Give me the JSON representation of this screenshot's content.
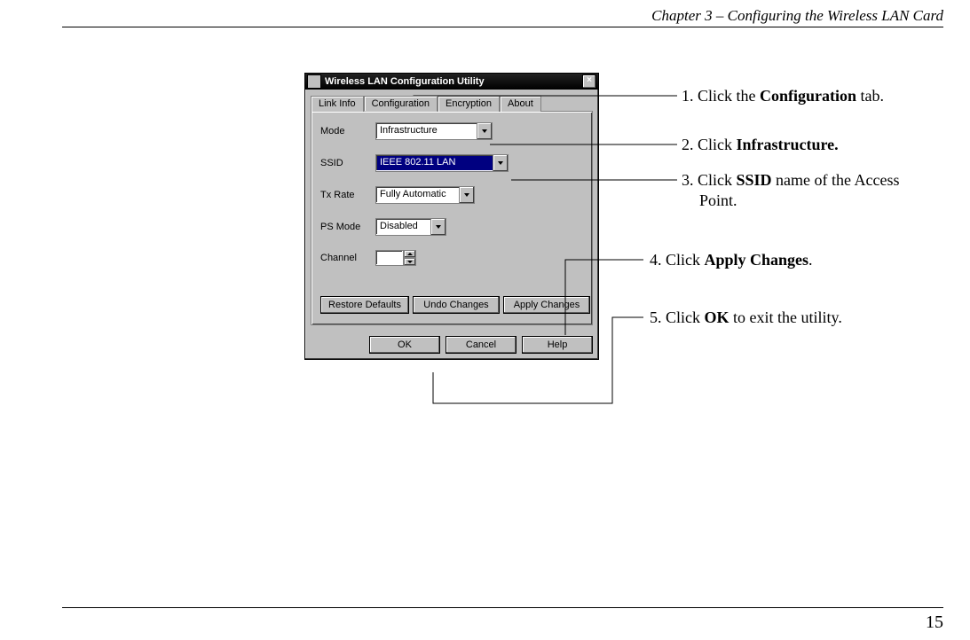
{
  "header": {
    "chapter_title": "Chapter 3 – Configuring the Wireless LAN Card"
  },
  "page_number": "15",
  "window": {
    "title": "Wireless LAN Configuration Utility",
    "close_glyph": "×",
    "tabs": {
      "link_info": "Link Info",
      "configuration": "Configuration",
      "encryption": "Encryption",
      "about": "About"
    },
    "fields": {
      "mode_label": "Mode",
      "mode_value": "Infrastructure",
      "ssid_label": "SSID",
      "ssid_value": "IEEE 802.11 LAN",
      "txrate_label": "Tx Rate",
      "txrate_value": "Fully Automatic",
      "psmode_label": "PS Mode",
      "psmode_value": "Disabled",
      "channel_label": "Channel",
      "channel_value": ""
    },
    "panel_buttons": {
      "restore": "Restore Defaults",
      "undo": "Undo Changes",
      "apply": "Apply Changes"
    },
    "dialog_buttons": {
      "ok": "OK",
      "cancel": "Cancel",
      "help": "Help"
    }
  },
  "callouts": {
    "c1_pre": "1. Click the ",
    "c1_bold": "Configuration",
    "c1_post": " tab.",
    "c2_pre": "2. Click ",
    "c2_bold": "Infrastructure.",
    "c3_pre": "3. Click ",
    "c3_bold": "SSID",
    "c3_post": " name of the Access",
    "c3_line2": "Point.",
    "c4_pre": "4. Click ",
    "c4_bold": "Apply Changes",
    "c4_post": ".",
    "c5_pre": "5. Click ",
    "c5_bold": "OK",
    "c5_post": " to exit the utility."
  }
}
